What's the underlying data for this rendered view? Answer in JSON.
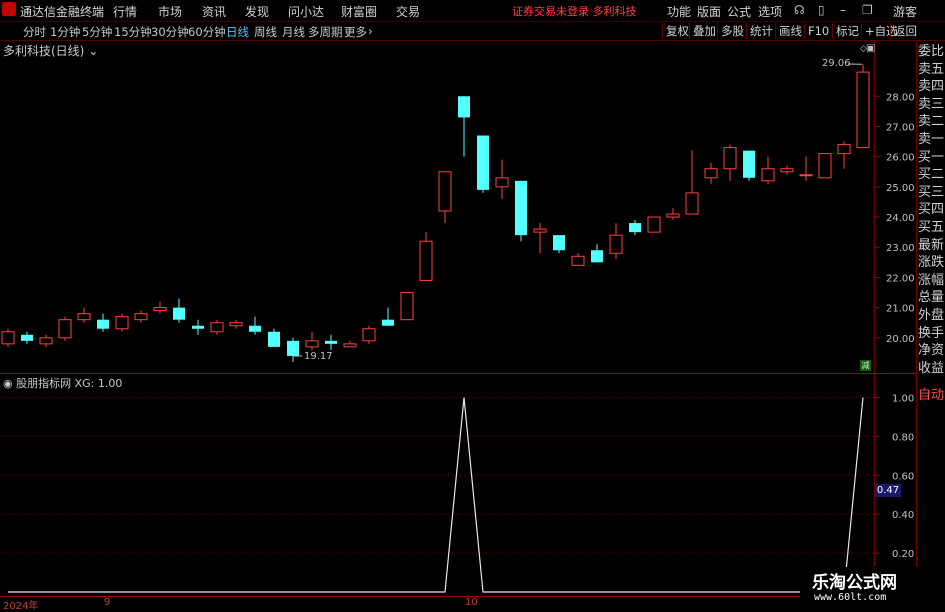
{
  "app": {
    "title": "通达信金融终端",
    "alert": "证券交易未登录",
    "stock_top": "多利科技",
    "visitor": "游客"
  },
  "menu": [
    "行情",
    "市场",
    "资讯",
    "发现",
    "问小达",
    "财富圈",
    "交易"
  ],
  "right_menu": [
    "功能",
    "版面",
    "公式",
    "选项"
  ],
  "periods": [
    "分时",
    "1分钟",
    "5分钟",
    "15分钟",
    "30分钟",
    "60分钟",
    "日线",
    "周线",
    "月线",
    "多周期",
    "更多"
  ],
  "active_period": "日线",
  "tools": [
    "复权",
    "叠加",
    "多股",
    "统计",
    "画线",
    "F10",
    "标记",
    "+自选",
    "返回"
  ],
  "chart_header": "多利科技(日线)",
  "indicator_header": "股朋指标网 XG: 1.00",
  "side_panel": [
    "委比",
    "卖五",
    "卖四",
    "卖三",
    "卖二",
    "卖一",
    "买一",
    "买二",
    "买三",
    "买四",
    "买五",
    "最新",
    "涨跌",
    "涨幅",
    "总量",
    "外盘",
    "换手",
    "净资",
    "收益"
  ],
  "auto_label": "自动",
  "badge": "减",
  "current_value": "0.47",
  "max_label": "29.06",
  "min_label": "19.17",
  "date_labels": [
    "2024年",
    "9",
    "10"
  ],
  "watermark": {
    "line1": "乐淘公式网",
    "line2": "www.60lt.com"
  },
  "colors": {
    "up": "#ff4040",
    "down": "#54ffff",
    "axis": "#a00000"
  },
  "chart_data": {
    "type": "candlestick",
    "price_ticks": [
      "28.00",
      "27.00",
      "26.00",
      "25.00",
      "24.00",
      "23.00",
      "22.00",
      "21.00",
      "20.00"
    ],
    "indicator_ticks": [
      "1.00",
      "0.80",
      "0.60",
      "0.40",
      "0.20"
    ],
    "price_range": [
      19.0,
      29.4
    ],
    "indicator_range": [
      0,
      1.1
    ],
    "candles": [
      {
        "o": 19.8,
        "c": 20.2,
        "h": 20.3,
        "l": 19.7
      },
      {
        "o": 20.1,
        "c": 19.9,
        "h": 20.2,
        "l": 19.8
      },
      {
        "o": 19.8,
        "c": 20.0,
        "h": 20.1,
        "l": 19.7
      },
      {
        "o": 20.0,
        "c": 20.6,
        "h": 20.7,
        "l": 19.9
      },
      {
        "o": 20.6,
        "c": 20.8,
        "h": 21.0,
        "l": 20.5
      },
      {
        "o": 20.6,
        "c": 20.3,
        "h": 20.8,
        "l": 20.2
      },
      {
        "o": 20.3,
        "c": 20.7,
        "h": 20.8,
        "l": 20.2
      },
      {
        "o": 20.6,
        "c": 20.8,
        "h": 20.9,
        "l": 20.5
      },
      {
        "o": 20.9,
        "c": 21.0,
        "h": 21.2,
        "l": 20.8
      },
      {
        "o": 21.0,
        "c": 20.6,
        "h": 21.3,
        "l": 20.5
      },
      {
        "o": 20.4,
        "c": 20.3,
        "h": 20.6,
        "l": 20.1
      },
      {
        "o": 20.2,
        "c": 20.5,
        "h": 20.6,
        "l": 20.1
      },
      {
        "o": 20.4,
        "c": 20.5,
        "h": 20.6,
        "l": 20.3
      },
      {
        "o": 20.4,
        "c": 20.2,
        "h": 20.7,
        "l": 20.1
      },
      {
        "o": 20.2,
        "c": 19.7,
        "h": 20.3,
        "l": 19.7
      },
      {
        "o": 19.9,
        "c": 19.4,
        "h": 20.0,
        "l": 19.2
      },
      {
        "o": 19.7,
        "c": 19.9,
        "h": 20.2,
        "l": 19.6
      },
      {
        "o": 19.9,
        "c": 19.8,
        "h": 20.1,
        "l": 19.6
      },
      {
        "o": 19.7,
        "c": 19.8,
        "h": 19.9,
        "l": 19.7
      },
      {
        "o": 19.9,
        "c": 20.3,
        "h": 20.4,
        "l": 19.8
      },
      {
        "o": 20.6,
        "c": 20.4,
        "h": 21.0,
        "l": 20.4
      },
      {
        "o": 20.6,
        "c": 21.5,
        "h": 21.5,
        "l": 20.6
      },
      {
        "o": 21.9,
        "c": 23.2,
        "h": 23.5,
        "l": 21.9
      },
      {
        "o": 24.2,
        "c": 25.5,
        "h": 25.5,
        "l": 23.8
      },
      {
        "o": 28.0,
        "c": 27.3,
        "h": 28.0,
        "l": 26.0
      },
      {
        "o": 26.7,
        "c": 24.9,
        "h": 26.7,
        "l": 24.8
      },
      {
        "o": 25.0,
        "c": 25.3,
        "h": 25.9,
        "l": 24.6
      },
      {
        "o": 25.2,
        "c": 23.4,
        "h": 25.2,
        "l": 23.2
      },
      {
        "o": 23.5,
        "c": 23.6,
        "h": 23.8,
        "l": 22.8
      },
      {
        "o": 23.4,
        "c": 22.9,
        "h": 23.4,
        "l": 22.8
      },
      {
        "o": 22.4,
        "c": 22.7,
        "h": 22.8,
        "l": 22.4
      },
      {
        "o": 22.9,
        "c": 22.5,
        "h": 23.1,
        "l": 22.5
      },
      {
        "o": 22.8,
        "c": 23.4,
        "h": 23.8,
        "l": 22.6
      },
      {
        "o": 23.8,
        "c": 23.5,
        "h": 23.9,
        "l": 23.4
      },
      {
        "o": 23.5,
        "c": 24.0,
        "h": 24.0,
        "l": 23.5
      },
      {
        "o": 24.0,
        "c": 24.1,
        "h": 24.3,
        "l": 23.9
      },
      {
        "o": 24.1,
        "c": 24.8,
        "h": 26.2,
        "l": 24.1
      },
      {
        "o": 25.3,
        "c": 25.6,
        "h": 25.8,
        "l": 25.1
      },
      {
        "o": 25.6,
        "c": 26.3,
        "h": 26.4,
        "l": 25.2
      },
      {
        "o": 26.2,
        "c": 25.3,
        "h": 26.2,
        "l": 25.2
      },
      {
        "o": 25.2,
        "c": 25.6,
        "h": 26.0,
        "l": 25.1
      },
      {
        "o": 25.5,
        "c": 25.6,
        "h": 25.7,
        "l": 25.4
      },
      {
        "o": 25.4,
        "c": 25.4,
        "h": 26.0,
        "l": 25.2
      },
      {
        "o": 25.3,
        "c": 26.1,
        "h": 26.1,
        "l": 25.3
      },
      {
        "o": 26.1,
        "c": 26.4,
        "h": 26.5,
        "l": 25.6
      },
      {
        "o": 26.3,
        "c": 28.8,
        "h": 29.06,
        "l": 26.3
      }
    ],
    "xg": [
      0,
      0,
      0,
      0,
      0,
      0,
      0,
      0,
      0,
      0,
      0,
      0,
      0,
      0,
      0,
      0,
      0,
      0,
      0,
      0,
      0,
      0,
      0,
      0,
      1,
      0,
      0,
      0,
      0,
      0,
      0,
      0,
      0,
      0,
      0,
      0,
      0,
      0,
      0,
      0,
      0,
      0,
      0,
      0,
      0,
      1
    ]
  }
}
